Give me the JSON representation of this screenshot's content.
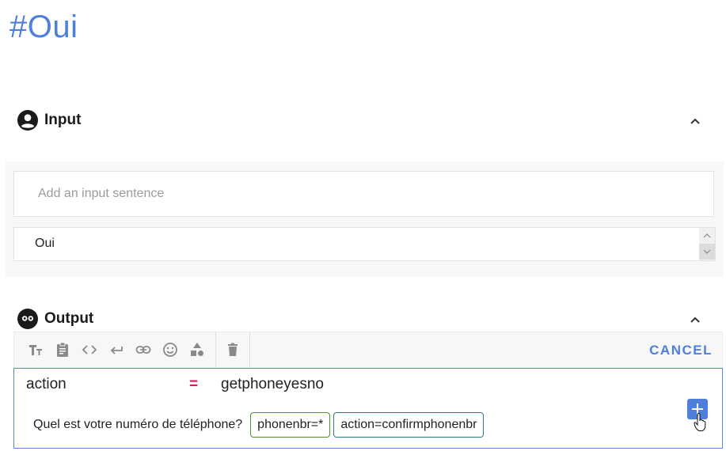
{
  "page": {
    "title": "#Oui"
  },
  "input_section": {
    "label": "Input",
    "icon": "account-circle-icon",
    "sentence_placeholder": "Add an input sentence",
    "example_value": "Oui"
  },
  "output_section": {
    "label": "Output",
    "icon": "bot-face-icon",
    "toolbar": {
      "tools": [
        "text-format-icon",
        "clipboard-icon",
        "code-icon",
        "return-arrow-icon",
        "link-icon",
        "emoji-icon",
        "shapes-icon",
        "trash-icon"
      ],
      "cancel_label": "CANCEL"
    },
    "slot": {
      "name": "action",
      "operator": "=",
      "value": "getphoneyesno"
    },
    "bot_reply": {
      "text": "Quel est votre numéro de téléphone?",
      "chips": [
        "phonenbr=*",
        "action=confirmphonenbr"
      ]
    }
  },
  "colors": {
    "accent": "#4f7fdc",
    "operator": "#d81b60",
    "chip_green": "#5a8f29",
    "chip_teal": "#2a7f86"
  }
}
